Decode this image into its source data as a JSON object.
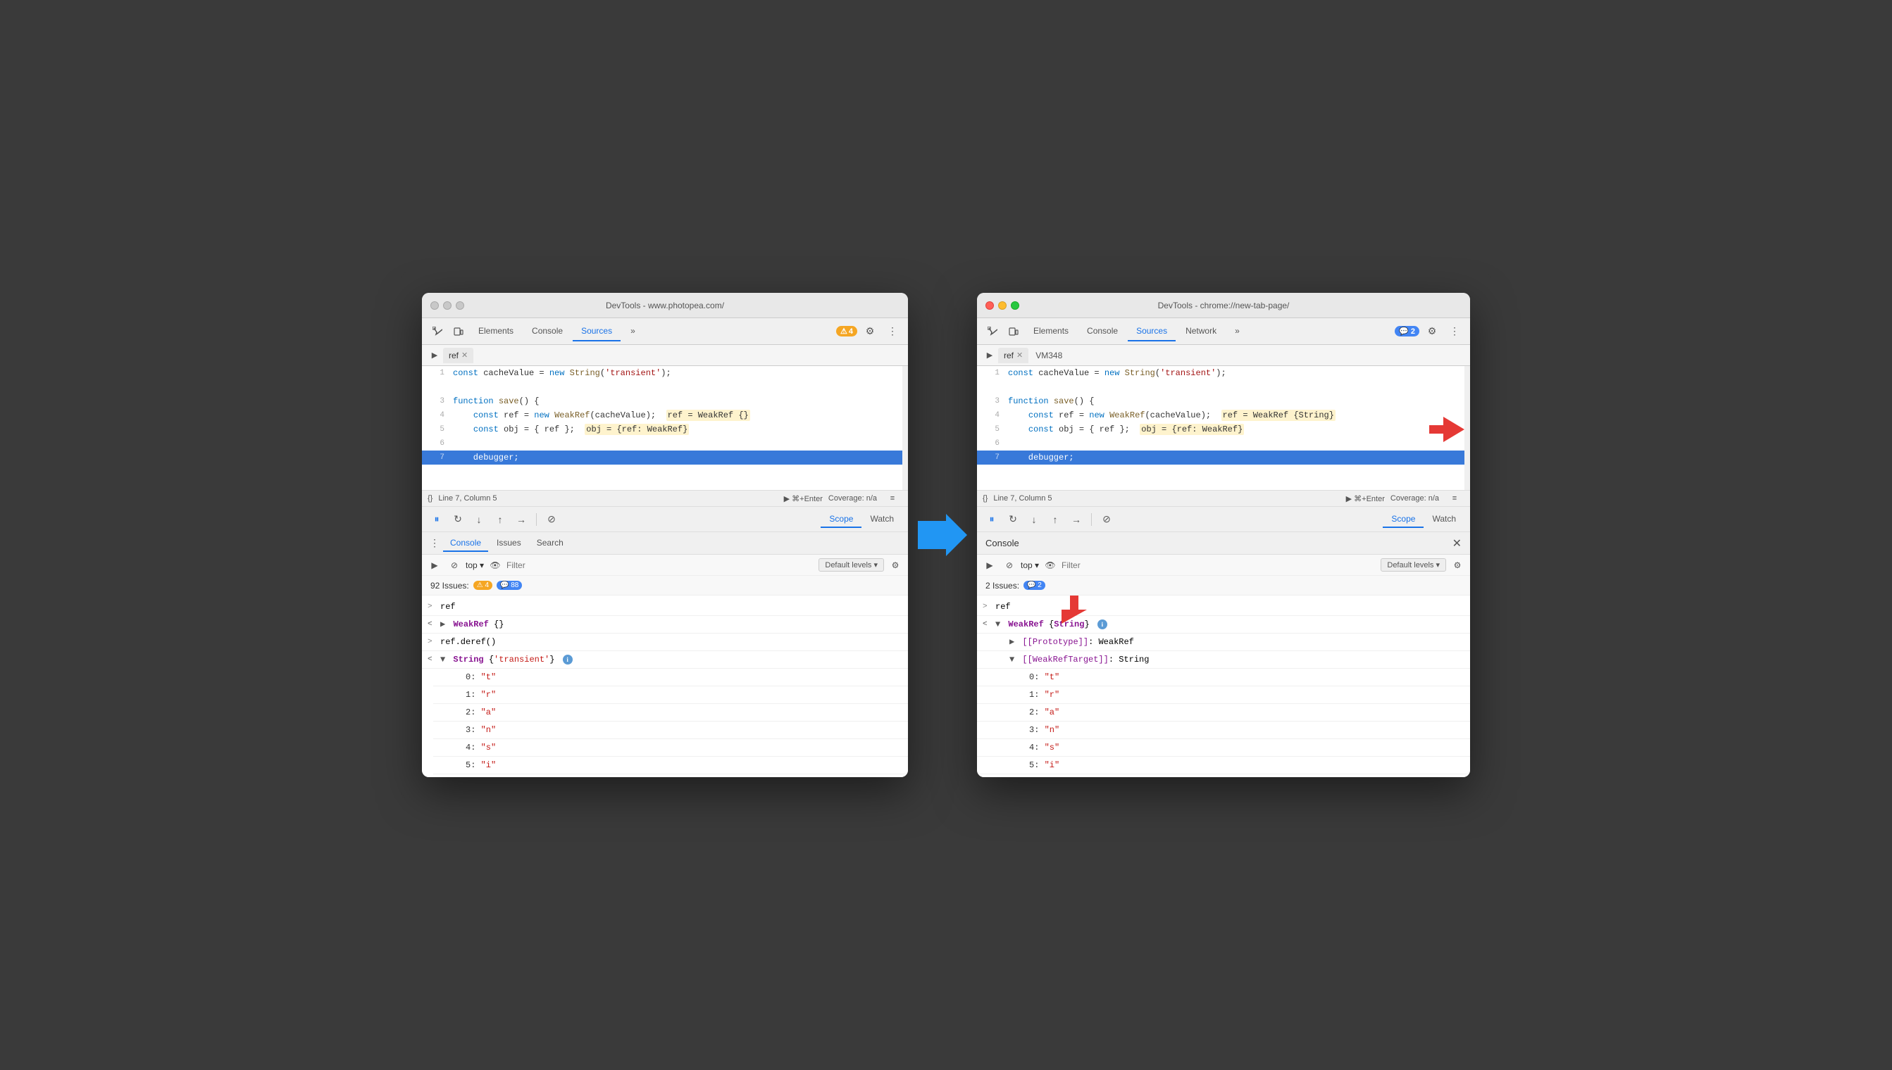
{
  "left_window": {
    "title": "DevTools - www.photopea.com/",
    "tabs": [
      "Elements",
      "Console",
      "Sources",
      "»"
    ],
    "active_tab": "Sources",
    "badge": "4",
    "file_tabs": [
      "ref"
    ],
    "code": {
      "lines": [
        {
          "num": "1",
          "content": "const cacheValue = new String('transient');",
          "active": false
        },
        {
          "num": "",
          "content": "",
          "active": false
        },
        {
          "num": "3",
          "content": "function save() {",
          "active": false
        },
        {
          "num": "4",
          "content": "    const ref = new WeakRef(cacheValue);  ref = WeakRef {}",
          "active": false,
          "highlight": true
        },
        {
          "num": "5",
          "content": "    const obj = { ref };  obj = {ref: WeakRef}",
          "active": false,
          "highlight2": true
        },
        {
          "num": "6",
          "content": "",
          "active": false
        },
        {
          "num": "7",
          "content": "    debugger;",
          "active": true
        }
      ]
    },
    "status_bar": {
      "left": "{}",
      "line_col": "Line 7, Column 5",
      "run": "⌘+Enter",
      "coverage": "Coverage: n/a"
    },
    "debugger": {
      "scope_tabs": [
        "Scope",
        "Watch"
      ],
      "active_scope": "Scope"
    },
    "bottom_tabs": [
      "Console",
      "Issues",
      "Search"
    ],
    "active_bottom": "Console",
    "console_filter": "Filter",
    "default_levels": "Default levels ▾",
    "issues_text": "92 Issues:",
    "issues_orange": "4",
    "issues_blue": "88",
    "console_lines": [
      {
        "arrow": ">",
        "content": "ref",
        "type": "ref"
      },
      {
        "arrow": "<",
        "content": "▶ WeakRef {}",
        "type": "weakref"
      },
      {
        "arrow": ">",
        "content": "ref.deref()",
        "type": "ref"
      },
      {
        "arrow": "<",
        "content": "▼ String {'transient'} ℹ",
        "type": "string_expand"
      },
      {
        "indent": "0:",
        "val": "\"t\""
      },
      {
        "indent": "1:",
        "val": "\"r\""
      },
      {
        "indent": "2:",
        "val": "\"a\""
      },
      {
        "indent": "3:",
        "val": "\"n\""
      },
      {
        "indent": "4:",
        "val": "\"s\""
      },
      {
        "indent": "5:",
        "val": "\"i\""
      }
    ]
  },
  "right_window": {
    "title": "DevTools - chrome://new-tab-page/",
    "tabs": [
      "Elements",
      "Console",
      "Sources",
      "Network",
      "»"
    ],
    "active_tab": "Sources",
    "badge_blue": "2",
    "file_tabs": [
      "ref",
      "VM348"
    ],
    "code": {
      "lines": [
        {
          "num": "1",
          "content": "const cacheValue = new String('transient');",
          "active": false
        },
        {
          "num": "",
          "content": "",
          "active": false
        },
        {
          "num": "3",
          "content": "function save() {",
          "active": false
        },
        {
          "num": "4",
          "content": "    const ref = new WeakRef(cacheValue);  ref = WeakRef {String}",
          "active": false,
          "highlight": true
        },
        {
          "num": "5",
          "content": "    const obj = { ref };  obj = {ref: WeakRef}",
          "active": false,
          "highlight2": true
        },
        {
          "num": "6",
          "content": "",
          "active": false
        },
        {
          "num": "7",
          "content": "    debugger;",
          "active": true
        }
      ]
    },
    "status_bar": {
      "left": "{}",
      "line_col": "Line 7, Column 5",
      "run": "⌘+Enter",
      "coverage": "Coverage: n/a"
    },
    "debugger": {
      "scope_tabs": [
        "Scope",
        "Watch"
      ],
      "active_scope": "Scope"
    },
    "console_title": "Console",
    "console_filter": "Filter",
    "default_levels": "Default levels ▾",
    "issues_text": "2 Issues:",
    "issues_blue_count": "2",
    "console_lines": [
      {
        "arrow": ">",
        "content": "ref",
        "type": "ref"
      },
      {
        "arrow": "<",
        "content": "▼ WeakRef {String} ℹ",
        "type": "weakref_expand"
      },
      {
        "indent": "▶ [[Prototype]]: WeakRef",
        "type": "proto"
      },
      {
        "indent": "▼ [[WeakRefTarget]]: String",
        "type": "target"
      },
      {
        "indent2": "0:",
        "val": "\"t\""
      },
      {
        "indent2": "1:",
        "val": "\"r\""
      },
      {
        "indent2": "2:",
        "val": "\"a\""
      },
      {
        "indent2": "3:",
        "val": "\"n\""
      },
      {
        "indent2": "4:",
        "val": "\"s\""
      },
      {
        "indent2": "5:",
        "val": "\"i\""
      }
    ]
  },
  "arrow_graphic": {
    "type": "blue_right_arrow"
  },
  "red_arrows": {
    "right_top": "pointing to highlight on line 4",
    "right_bottom": "pointing to issues badge"
  }
}
